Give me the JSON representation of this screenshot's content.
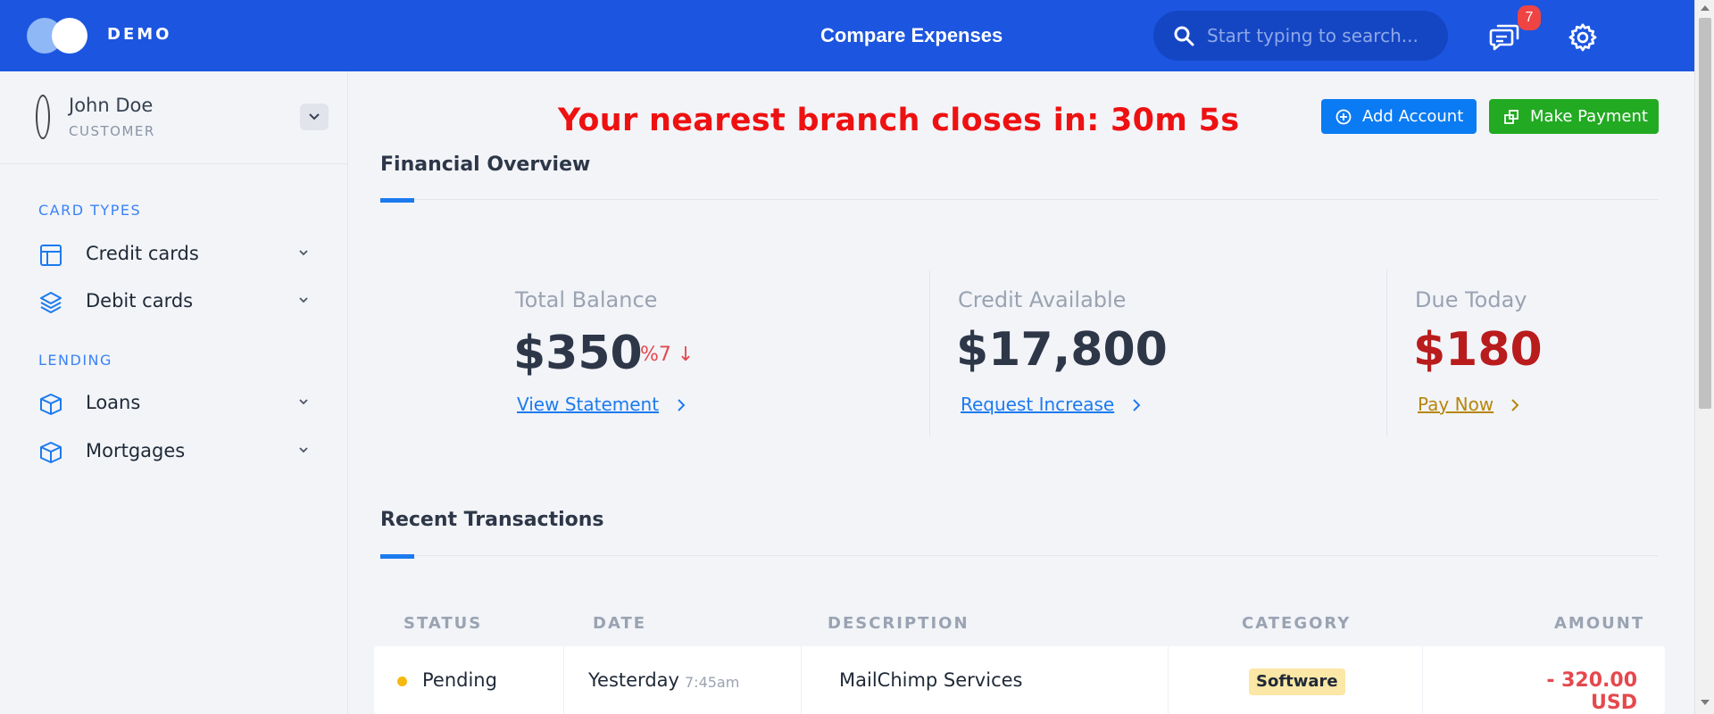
{
  "header": {
    "brand": "DEMO",
    "title": "Compare Expenses",
    "search_placeholder": "Start typing to search...",
    "notification_count": "7",
    "colors": {
      "bar": "#1c55e0",
      "search_bg": "#1446c4"
    }
  },
  "user": {
    "name": "John Doe",
    "role": "CUSTOMER"
  },
  "sidebar": {
    "sections": [
      {
        "label": "CARD TYPES",
        "items": [
          {
            "label": "Credit cards",
            "icon": "layout-icon"
          },
          {
            "label": "Debit cards",
            "icon": "layers-icon"
          }
        ]
      },
      {
        "label": "LENDING",
        "items": [
          {
            "label": "Loans",
            "icon": "box-icon"
          },
          {
            "label": "Mortgages",
            "icon": "box-icon"
          }
        ]
      }
    ]
  },
  "banner": {
    "countdown": "Your nearest branch closes in: 30m 5s",
    "color": "#ee1111"
  },
  "actions": {
    "add_account": "Add Account",
    "make_payment": "Make Payment",
    "colors": {
      "add": "#0b7bf3",
      "pay": "#22aa22"
    }
  },
  "overview": {
    "title": "Financial Overview",
    "stats": [
      {
        "label": "Total Balance",
        "value": "$350",
        "change": "%7 ↓",
        "link": "View Statement"
      },
      {
        "label": "Credit Available",
        "value": "$17,800",
        "link": "Request Increase"
      },
      {
        "label": "Due Today",
        "value": "$180",
        "link": "Pay Now",
        "value_color": "#b91c1c",
        "link_color": "#b8860b"
      }
    ]
  },
  "transactions": {
    "title": "Recent Transactions",
    "columns": [
      "STATUS",
      "DATE",
      "DESCRIPTION",
      "CATEGORY",
      "AMOUNT"
    ],
    "rows": [
      {
        "status": "Pending",
        "date": "Yesterday",
        "time": "7:45am",
        "description": "MailChimp Services",
        "category": "Software",
        "amount": "- 320.00 USD"
      }
    ]
  }
}
